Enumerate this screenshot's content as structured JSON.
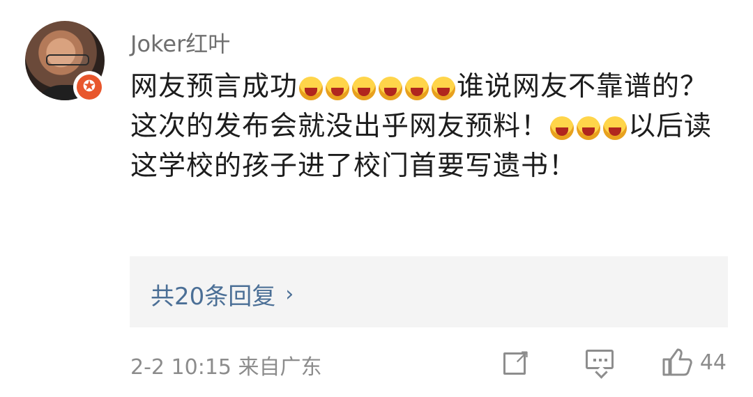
{
  "user": {
    "name": "Joker红叶"
  },
  "comment": {
    "text_part1": "网友预言成功",
    "text_part2": "谁说网友不靠谱的？这次的发布会就没出乎网友预料！",
    "text_part3": "以后读这学校的孩子进了校门首要写遗书！",
    "emojis": {
      "group1_count": 6,
      "group2_count": 2,
      "group3_count": 1,
      "emoji_name": "laughing-face-emoji"
    }
  },
  "replies": {
    "label": "共20条回复",
    "chevron": "›"
  },
  "meta": {
    "datetime": "2-2 10:15",
    "location": "来自广东"
  },
  "actions": {
    "share_icon": "share-icon",
    "comment_icon": "comment-icon",
    "like_icon": "thumbs-up-icon",
    "like_count": "44"
  },
  "colors": {
    "link": "#4b6f96",
    "meta": "#8c8c8c",
    "text": "#1c1c1c",
    "reply_bg": "#f4f4f4",
    "badge": "#e8562c"
  }
}
